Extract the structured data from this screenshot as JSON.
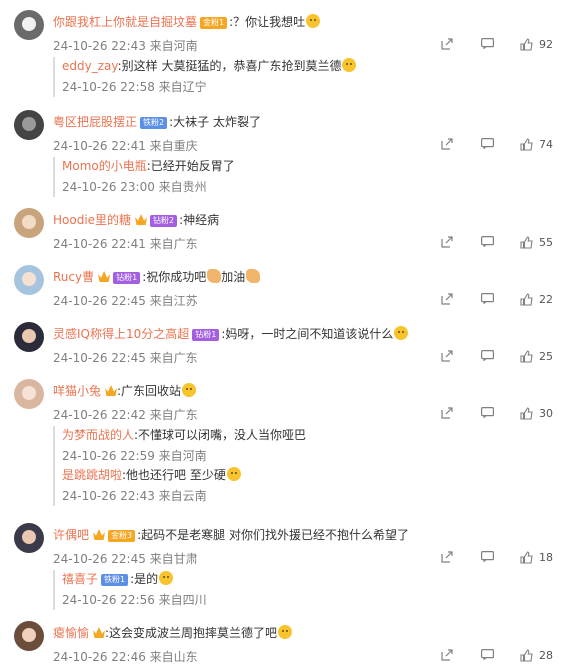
{
  "colors": {
    "username": "#eb7350",
    "meta": "#808080",
    "badge_gold": "#f5a623",
    "badge_blue": "#5c8fe6",
    "badge_purple": "#a35fe0"
  },
  "comments": [
    {
      "user": "你跟我杠上你就是自掘坟墓",
      "badge": "金粉1",
      "badge_type": "gold",
      "text": ":？你让我想吐",
      "emoji": true,
      "time": "24-10-26 22:43 来自河南",
      "likes": "92",
      "avatar_color": "#6a6a6a",
      "face_color": "#f1f1f1",
      "replies": [
        {
          "user": "eddy_zay",
          "text": ":别这样 大莫挺猛的，恭喜广东抢到莫兰德",
          "emoji": true,
          "time": "24-10-26 22:58 来自辽宁"
        }
      ]
    },
    {
      "user": "粤区把屁股摆正",
      "badge": "铁粉2",
      "badge_type": "blue",
      "text": ":大袜子 太炸裂了",
      "emoji": false,
      "time": "24-10-26 22:41 来自重庆",
      "likes": "74",
      "avatar_color": "#444444",
      "face_color": "#9a9a9a",
      "replies": [
        {
          "user": "Momo的小电瓶",
          "text": ":已经开始反胃了",
          "emoji": false,
          "time": "24-10-26 23:00 来自贵州"
        }
      ]
    },
    {
      "user": "Hoodie里的糖",
      "badge": "钻粉2",
      "badge_type": "purple",
      "text": ":神经病",
      "emoji": false,
      "time": "24-10-26 22:41 来自广东",
      "likes": "55",
      "avatar_color": "#c9a37c",
      "face_color": "#f2dcc6"
    },
    {
      "user": "Rucy曹",
      "badge": "钻粉1",
      "badge_type": "purple",
      "text": ":祝你成功吧",
      "text2": "加油",
      "hands": true,
      "time": "24-10-26 22:45 来自江苏",
      "likes": "22",
      "avatar_color": "#a7c4df",
      "face_color": "#f3e2d3"
    },
    {
      "user": "灵感IQ称得上10分之高超",
      "badge": "钻粉1",
      "badge_type": "purple",
      "text": ":妈呀，一时之间不知道该说什么",
      "emoji": true,
      "time": "24-10-26 22:45 来自广东",
      "likes": "25",
      "avatar_color": "#2b2b3a",
      "face_color": "#e8c9b0"
    },
    {
      "user": "咩猫小兔",
      "badge": "",
      "badge_type": "",
      "text": ":广东回收站",
      "emoji": true,
      "time": "24-10-26 22:42 来自广东",
      "likes": "30",
      "avatar_color": "#d9b6a0",
      "face_color": "#f6e2d6",
      "replies": [
        {
          "user": "为梦而战的人",
          "text": ":不懂球可以闭嘴，没人当你哑巴",
          "emoji": false,
          "time": "24-10-26 22:59 来自河南"
        },
        {
          "user": "是跳跳胡啦",
          "text": ":他也还行吧 至少硬",
          "emoji": true,
          "time": "24-10-26 22:43 来自云南"
        }
      ]
    },
    {
      "user": "许偶吧",
      "badge": "金粉3",
      "badge_type": "gold",
      "text": ":起码不是老寒腿 对你们找外援已经不抱什么希望了",
      "emoji": false,
      "time": "24-10-26 22:45 来自甘肃",
      "likes": "18",
      "avatar_color": "#3a3a4a",
      "face_color": "#e9c7b3",
      "replies": [
        {
          "user": "禧喜子",
          "badge": "铁粉1",
          "text": ":是的",
          "emoji": true,
          "time": "24-10-26 22:56 来自四川"
        }
      ]
    },
    {
      "user": "瘪愉愉",
      "badge": "",
      "badge_type": "",
      "text": ":这会变成波兰周抱摔莫兰德了吧",
      "emoji": true,
      "time": "24-10-26 22:46 来自山东",
      "likes": "28",
      "avatar_color": "#6b4d3b",
      "face_color": "#efd1bd"
    }
  ]
}
